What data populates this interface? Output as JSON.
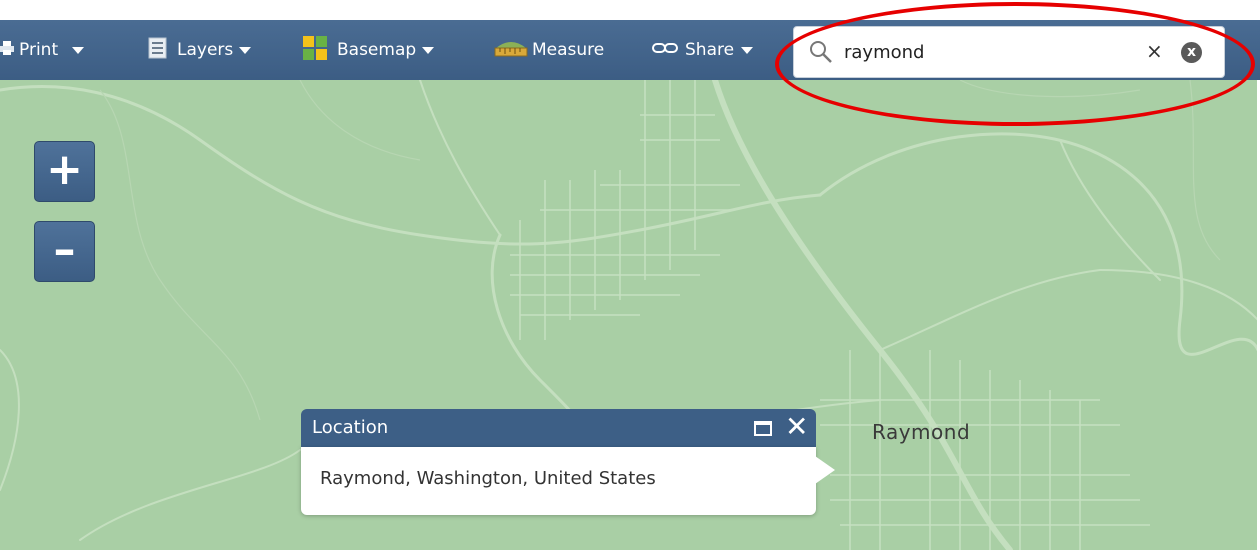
{
  "toolbar": {
    "print_label": "Print",
    "layers_label": "Layers",
    "basemap_label": "Basemap",
    "measure_label": "Measure",
    "share_label": "Share"
  },
  "search": {
    "value": "raymond",
    "clear_glyph": "×",
    "reset_glyph": "x"
  },
  "zoom": {
    "in_label": "+",
    "out_label": "–"
  },
  "map": {
    "place_label": "Raymond"
  },
  "popup": {
    "title": "Location",
    "text": "Raymond, Washington, United States",
    "close_glyph": "✕"
  },
  "icons": {
    "print": "printer-icon",
    "layers": "layers-icon",
    "basemap": "basemap-grid-icon",
    "measure": "measure-ruler-icon",
    "share": "link-icon",
    "search": "search-icon"
  },
  "colors": {
    "toolbar": "#3c5d84",
    "map_background": "#a9cfa5",
    "road": "#c7e0c2",
    "highlight": "#e60000"
  }
}
